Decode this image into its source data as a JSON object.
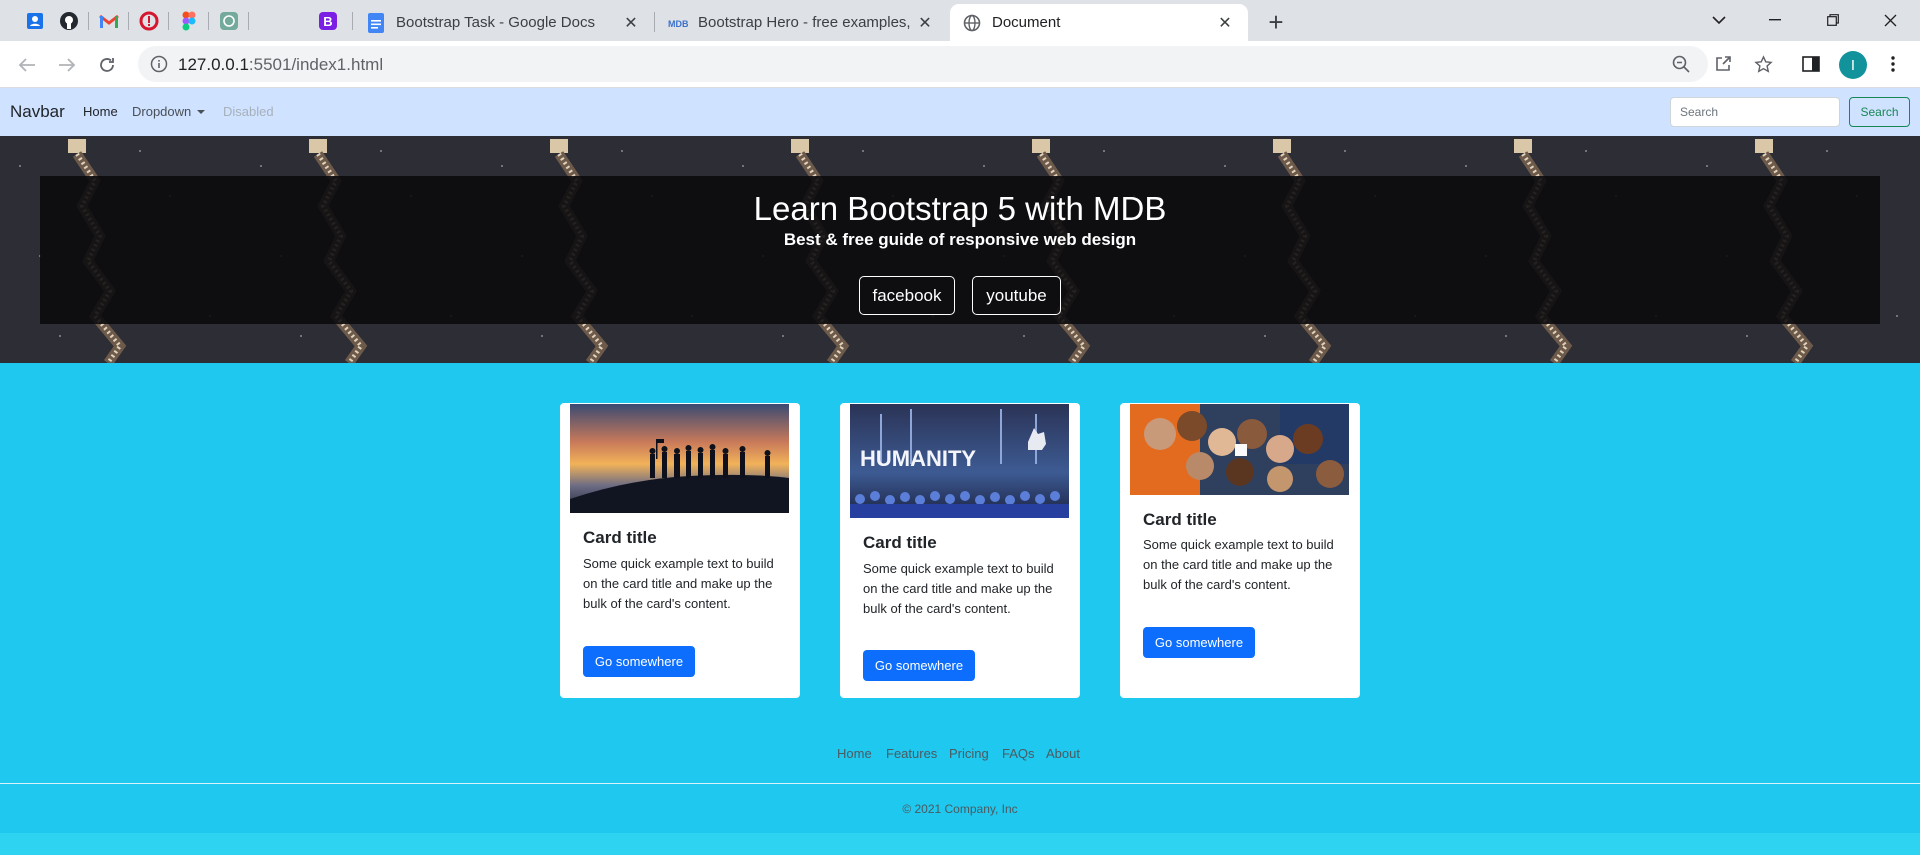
{
  "browser": {
    "pinned_tabs": [
      "contacts-icon",
      "github-icon",
      "gmail-icon",
      "opera-icon",
      "figma-icon",
      "chatgpt-icon",
      "bootstrap-icon"
    ],
    "tabs": [
      {
        "title": "Bootstrap Task - Google Docs",
        "icon": "google-docs-icon"
      },
      {
        "title": "Bootstrap Hero - free examples, t",
        "icon": "mdb-icon"
      },
      {
        "title": "Document",
        "icon": "globe-icon"
      }
    ],
    "url_host": "127.0.0.1",
    "url_rest": ":5501/index1.html",
    "profile_initial": "I"
  },
  "navbar": {
    "brand": "Navbar",
    "links": [
      "Home",
      "Dropdown",
      "Disabled"
    ],
    "search_placeholder": "Search",
    "search_button": "Search"
  },
  "hero": {
    "title": "Learn Bootstrap 5 with MDB",
    "subtitle": "Best & free guide of responsive web design",
    "buttons": [
      "facebook",
      "youtube"
    ]
  },
  "cards": [
    {
      "title": "Card title",
      "text": "Some quick example text to build on the card title and make up the bulk of the card's content.",
      "button": "Go somewhere",
      "image": "sunset-silhouettes-image"
    },
    {
      "title": "Card title",
      "text": "Some quick example text to build on the card title and make up the bulk of the card's content.",
      "button": "Go somewhere",
      "image": "humanity-stage-image",
      "image_caption": "HUMANITY"
    },
    {
      "title": "Card title",
      "text": "Some quick example text to build on the card title and make up the bulk of the card's content.",
      "button": "Go somewhere",
      "image": "group-selfie-image"
    }
  ],
  "footer": {
    "links": [
      "Home",
      "Features",
      "Pricing",
      "FAQs",
      "About"
    ],
    "copyright": "© 2021 Company, Inc"
  },
  "colors": {
    "page_bg": "#1ec8ee",
    "navbar_bg": "#cfe2ff",
    "primary": "#0d6efd",
    "success": "#198754"
  }
}
